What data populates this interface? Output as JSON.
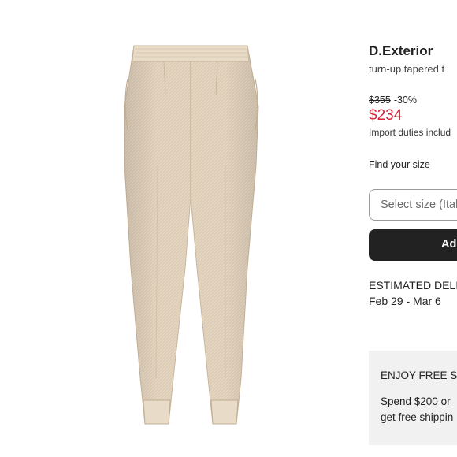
{
  "product": {
    "brand": "D.Exterior",
    "name": "turn-up tapered t",
    "image_alt": "Beige tapered trousers, rear view"
  },
  "pricing": {
    "original": "$355",
    "discount": "-30%",
    "sale": "$234",
    "duties_note": "Import duties includ"
  },
  "size": {
    "guide_link": "Find your size",
    "select_placeholder": "Select size (Ital"
  },
  "cart": {
    "add_label": "Ad"
  },
  "delivery": {
    "label": "ESTIMATED DELIV",
    "dates": "Feb 29 - Mar 6"
  },
  "shipping_promo": {
    "title": "ENJOY FREE SH",
    "line1": "Spend $200 or",
    "line2": "get free shippin"
  },
  "colors": {
    "accent_sale": "#d6213a",
    "button_bg": "#222222",
    "promo_bg": "#f1f1f1",
    "fabric": "#e3d4bf"
  }
}
